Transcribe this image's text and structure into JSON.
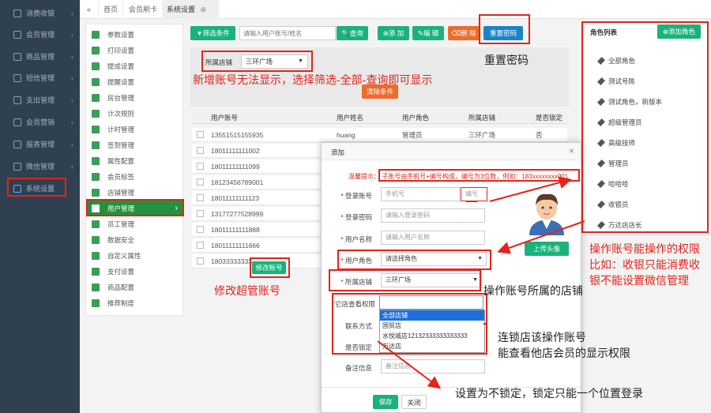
{
  "nav": {
    "items": [
      {
        "label": "消费收银",
        "chev": "‹"
      },
      {
        "label": "会员管理",
        "chev": "‹"
      },
      {
        "label": "商品管理",
        "chev": "‹"
      },
      {
        "label": "短信管理",
        "chev": "‹"
      },
      {
        "label": "支出管理",
        "chev": "‹"
      },
      {
        "label": "会员营销",
        "chev": "‹"
      },
      {
        "label": "报表管理",
        "chev": "‹"
      },
      {
        "label": "微信管理",
        "chev": "‹"
      },
      {
        "label": "系统设置",
        "chev": ""
      }
    ]
  },
  "tabs": {
    "back": "«",
    "home": "首页",
    "card": "会员刷卡",
    "settings": "系统设置",
    "settings_close": "⊗"
  },
  "midmenu": [
    "参数设置",
    "打印设置",
    "提成设置",
    "提醒设置",
    "房台管理",
    "计次规则",
    "计时管理",
    "签到管理",
    "属性配置",
    "会员标签",
    "店铺管理",
    "用户管理",
    "员工管理",
    "数据安全",
    "自定义属性",
    "支付设置",
    "商品配置",
    "推荐制度"
  ],
  "toolbar": {
    "filter": "▼筛选条件",
    "search_placeholder": "请输入用户账号/姓名",
    "query": "🔍查询",
    "add": "⊕添 加",
    "edit": "✎编 辑",
    "delete": "⌫删 除",
    "reset_pwd": "重置密码"
  },
  "filter": {
    "store_label": "所属店铺",
    "store_value": "三环广场",
    "clear": "清除条件"
  },
  "table": {
    "headers": [
      "用户账号",
      "用户姓名",
      "用户角色",
      "所属店铺",
      "是否锁定"
    ],
    "rows": [
      [
        "13551515155935",
        "huang",
        "管理员",
        "三环广场",
        "否"
      ],
      [
        "18011111111002",
        "",
        "",
        "",
        ""
      ],
      [
        "18011111111099",
        "",
        "",
        "",
        ""
      ],
      [
        "18123456789001",
        "",
        "",
        "",
        ""
      ],
      [
        "18011111111123",
        "",
        "",
        "",
        ""
      ],
      [
        "13177277528999",
        "",
        "",
        "",
        ""
      ],
      [
        "18011111111888",
        "",
        "",
        "",
        ""
      ],
      [
        "18011111111666",
        "",
        "",
        "",
        ""
      ],
      [
        "18033333333",
        "",
        "",
        "",
        ""
      ]
    ],
    "edit_super": "修改账号"
  },
  "roles": {
    "title": "角色列表",
    "add": "⊕添加角色",
    "items": [
      "全部角色",
      "测试号陈",
      "测试角色，新版本",
      "超级管理员",
      "高级技师",
      "管理员",
      "哈哈哈",
      "收银员",
      "万达店店长"
    ]
  },
  "modal": {
    "title": "添加",
    "close": "×",
    "hint_label": "温馨提示：",
    "hint_text": "子账号由手机号+编号构成，编号为3位数，例如：183xxxxxxxx001",
    "login_label": "登录账号",
    "phone_placeholder": "手机号",
    "code_placeholder": "编号",
    "pwd_label": "登录密码",
    "pwd_placeholder": "请输入登录密码",
    "name_label": "用户名称",
    "name_placeholder": "请输入用户名称",
    "role_label": "用户角色",
    "role_placeholder": "请选择角色",
    "store_label": "所属店铺",
    "store_value": "三环广场",
    "view_label": "它店查看权限",
    "contact_label": "联系方式",
    "lock_label": "是否锁定",
    "note_label": "备注信息",
    "note_placeholder": "备注信息",
    "upload": "上传头像",
    "save": "保存",
    "close_btn": "关闭",
    "dropdown": [
      "全部店铺",
      "国贸店",
      "水悦城店12132333333333333",
      "万达店"
    ]
  },
  "annotations": {
    "reset": "重置密码",
    "filter_tip": "新增账号无法显示，选择筛选-全部-查询即可显示",
    "super_tip": "修改超管账号",
    "perm1": "操作账号能操作的权限",
    "perm2": "比如：收银只能消费收",
    "perm3": "银不能设置微信管理",
    "store_tip": "操作账号所属的店铺",
    "chain1": "连锁店该操作账号",
    "chain2": "能查看他店会员的显示权限",
    "lock_tip": "设置为不锁定，锁定只能一个位置登录"
  },
  "colors": {
    "nav_bg": "#2f4050",
    "green": "#1ab27b",
    "red": "#d9534f",
    "orange": "#ed6b2c",
    "blue": "#1c84c6",
    "annotation": "#e3241b"
  }
}
